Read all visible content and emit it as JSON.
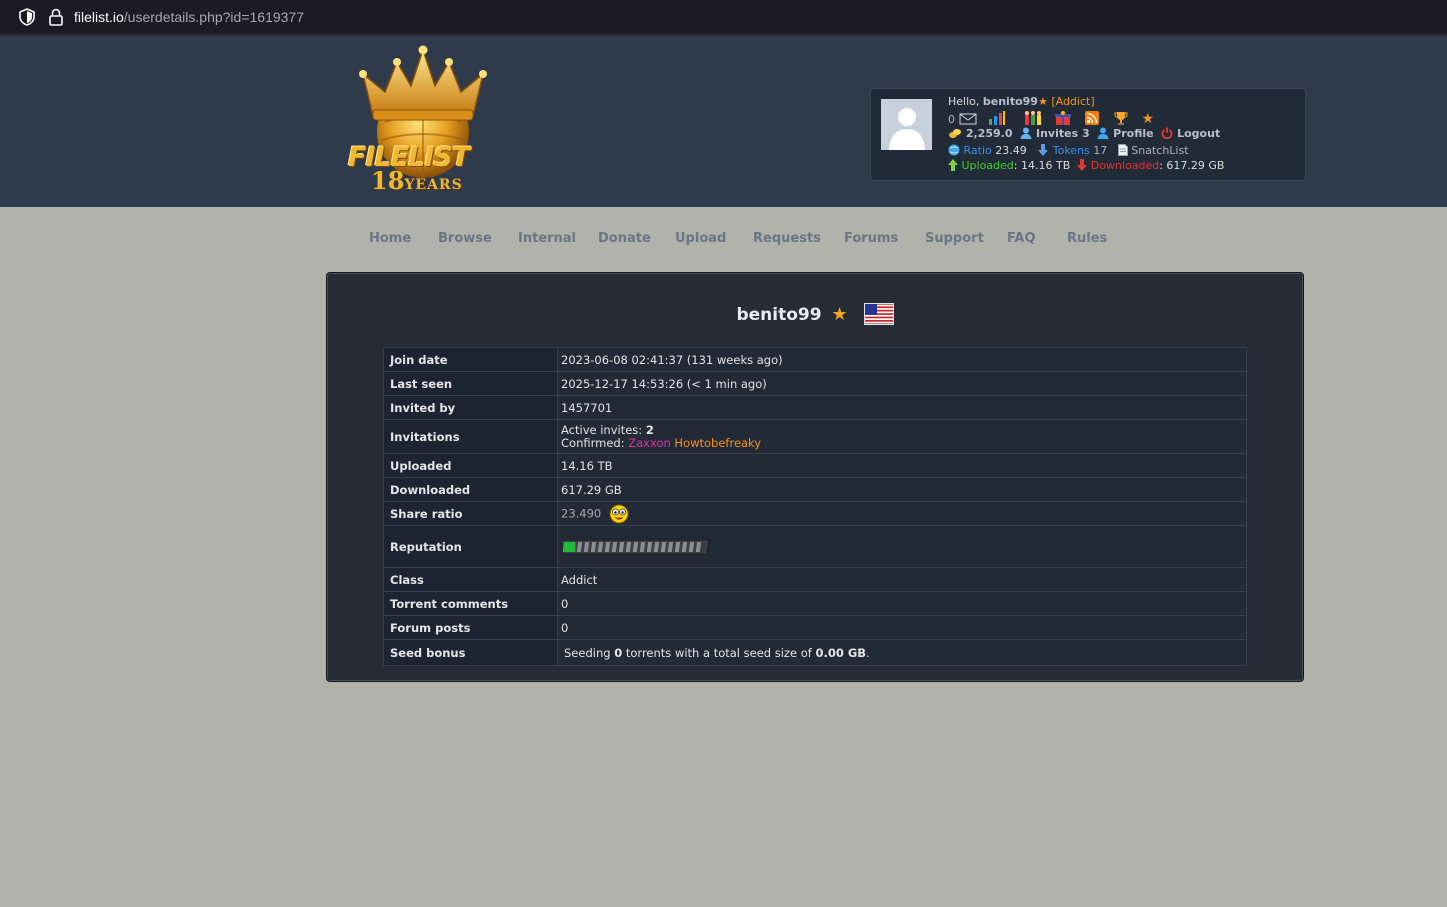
{
  "browser": {
    "url_host": "filelist.io",
    "url_path": "/userdetails.php?id=1619377"
  },
  "logo": {
    "text": "FILELIST",
    "years_number": "18",
    "years_label": "YEARS"
  },
  "userpanel": {
    "greeting": "Hello,",
    "username": "benito99",
    "class": "[Addict]",
    "messages": "0",
    "bonus": "2,259.0",
    "invites_label": "Invites",
    "invites": "3",
    "profile": "Profile",
    "logout": "Logout",
    "ratio_label": "Ratio",
    "ratio": "23.49",
    "tokens_label": "Tokens",
    "tokens": "17",
    "snatchlist": "SnatchList",
    "uploaded_label": "Uploaded",
    "uploaded": ": 14.16 TB",
    "downloaded_label": "Downloaded",
    "downloaded": ": 617.29 GB"
  },
  "nav": [
    "Home",
    "Browse",
    "Internal",
    "Donate",
    "Upload",
    "Requests",
    "Forums",
    "Support",
    "FAQ",
    "Rules"
  ],
  "profile": {
    "username": "benito99",
    "star": "★",
    "rows": {
      "join_date_label": "Join date",
      "join_date": "2023-06-08 02:41:37 (131 weeks ago)",
      "last_seen_label": "Last seen",
      "last_seen": "2025-12-17 14:53:26 (< 1 min ago)",
      "invited_by_label": "Invited by",
      "invited_by": "1457701",
      "invitations_label": "Invitations",
      "active_invites_label": "Active invites:",
      "active_invites": "2",
      "confirmed_label": "Confirmed:",
      "confirmed_1": "Zaxxon",
      "confirmed_2": "Howtobefreaky",
      "uploaded_label": "Uploaded",
      "uploaded": "14.16 TB",
      "downloaded_label": "Downloaded",
      "downloaded": "617.29 GB",
      "share_ratio_label": "Share ratio",
      "share_ratio": "23.490",
      "reputation_label": "Reputation",
      "reputation_fill": 0.08,
      "class_label": "Class",
      "class": "Addict",
      "torrent_comments_label": "Torrent comments",
      "torrent_comments": "0",
      "forum_posts_label": "Forum posts",
      "forum_posts": "0",
      "seed_bonus_label": "Seed bonus",
      "seed_pre": "Seeding",
      "seed_count": "0",
      "seed_mid": "torrents with a total seed size of",
      "seed_size": "0.00 GB",
      "seed_post": "."
    }
  },
  "colors": {
    "header_bg": "#2f3b4a",
    "page_bg": "#b1b2aa",
    "accent_orange": "#f7931e",
    "link_pink": "#e02fa6"
  }
}
